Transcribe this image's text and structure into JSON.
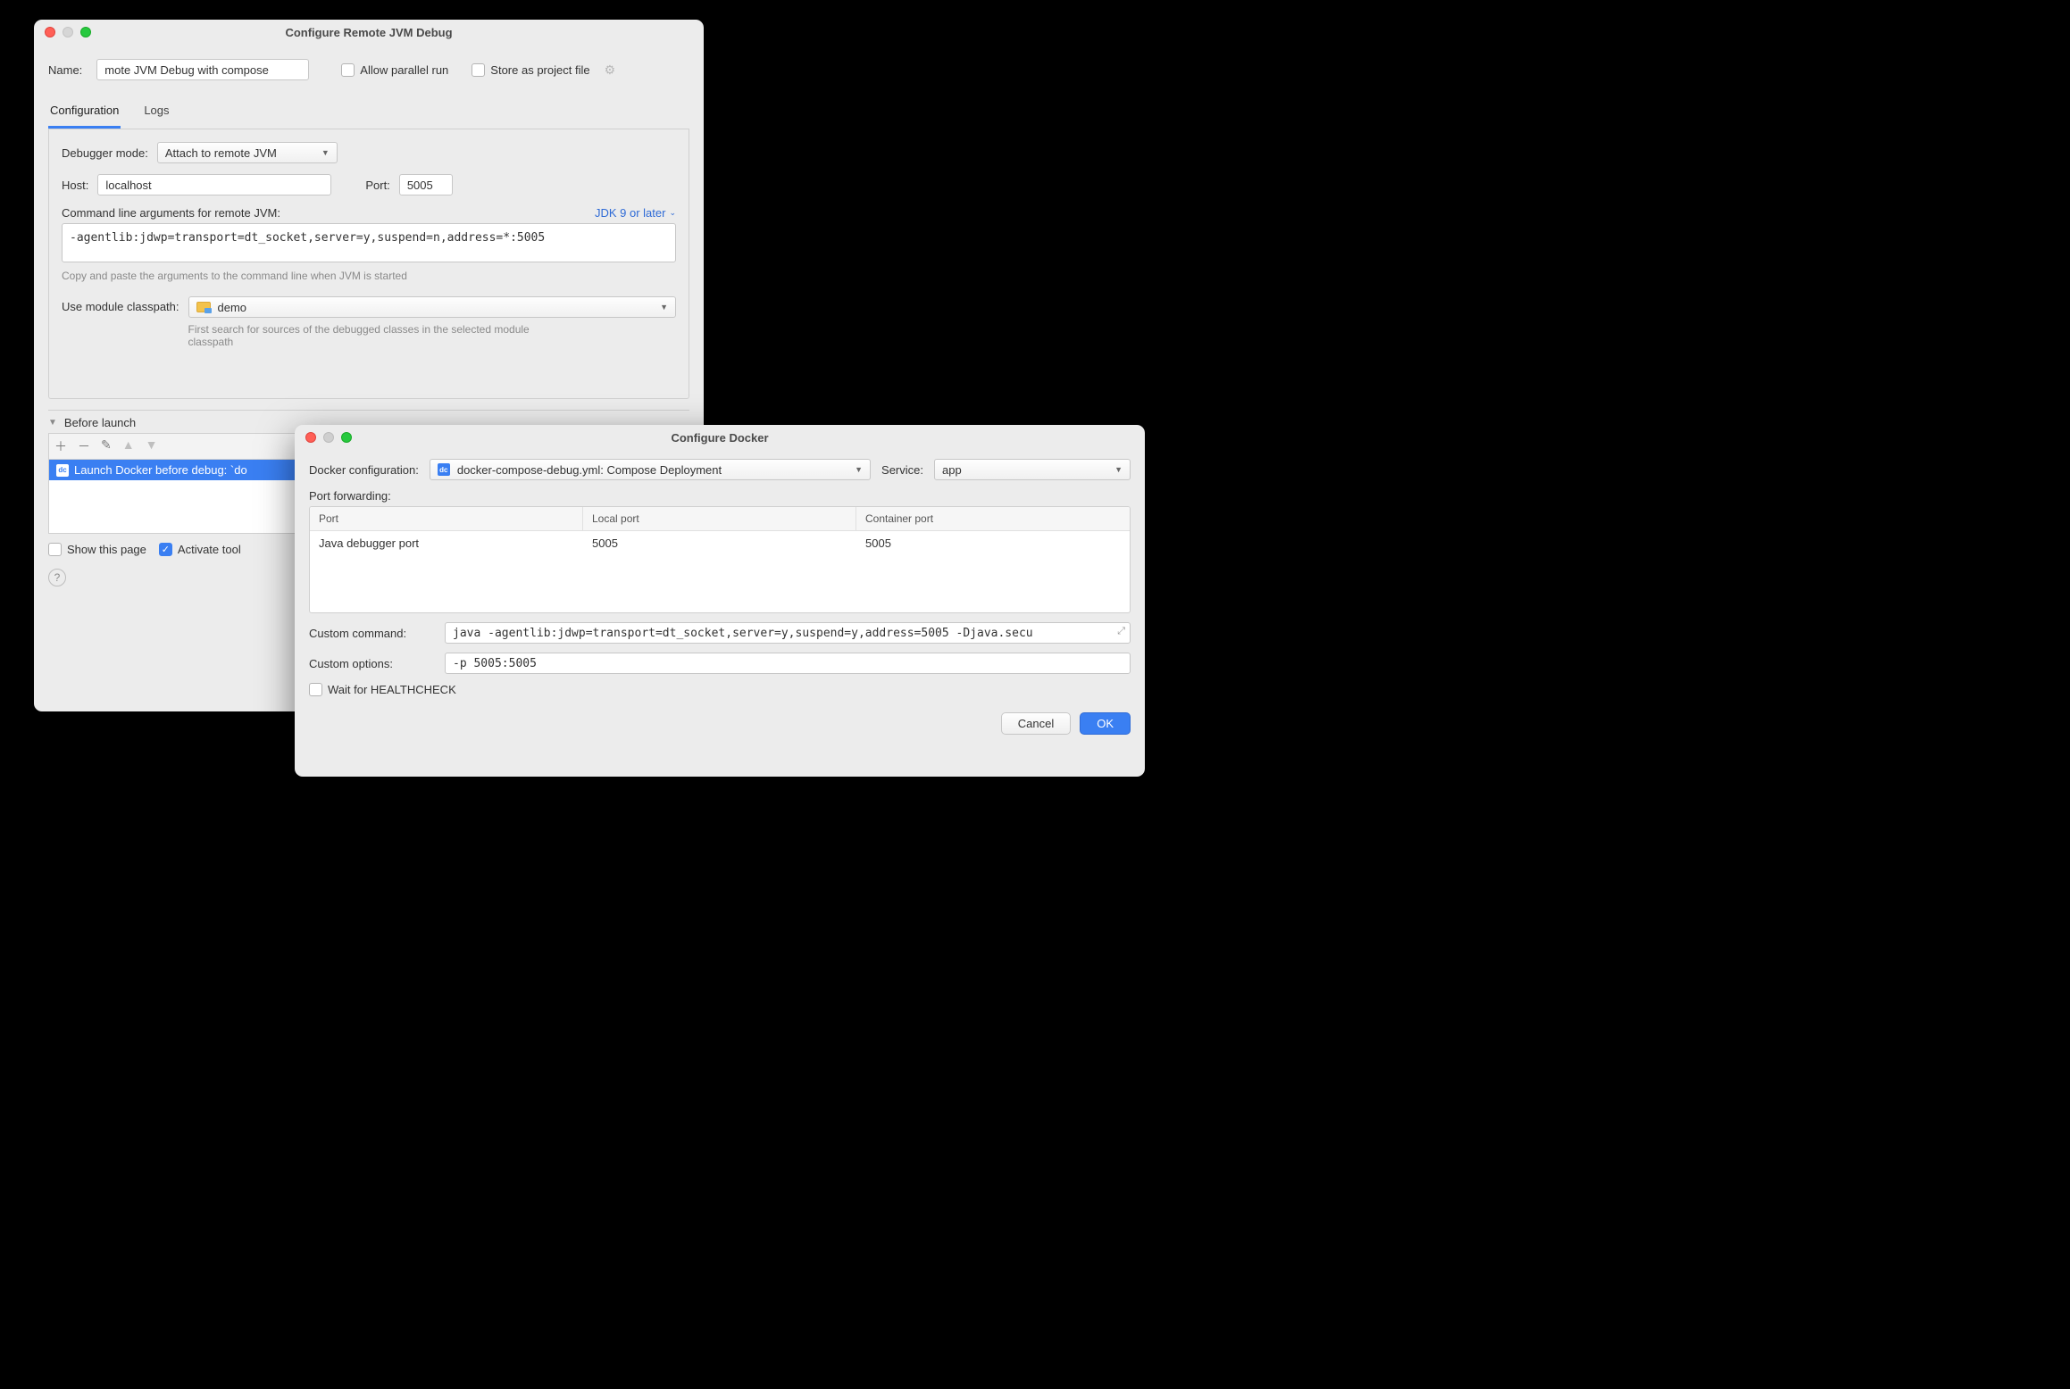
{
  "win1": {
    "title": "Configure Remote JVM Debug",
    "name_label": "Name:",
    "name_value": "mote JVM Debug with compose",
    "allow_parallel": "Allow parallel run",
    "store_as_file": "Store as project file",
    "tabs": {
      "configuration": "Configuration",
      "logs": "Logs"
    },
    "debugger_mode_label": "Debugger mode:",
    "debugger_mode_value": "Attach to remote JVM",
    "host_label": "Host:",
    "host_value": "localhost",
    "port_label": "Port:",
    "port_value": "5005",
    "cli_args_label": "Command line arguments for remote JVM:",
    "jdk_label": "JDK 9 or later",
    "cli_args_value": "-agentlib:jdwp=transport=dt_socket,server=y,suspend=n,address=*:5005",
    "cli_hint": "Copy and paste the arguments to the command line when JVM is started",
    "classpath_label": "Use module classpath:",
    "classpath_value": "demo",
    "classpath_hint": "First search for sources of the debugged classes in the selected module classpath",
    "before_launch": "Before launch",
    "before_item": "Launch Docker before debug:  `do",
    "show_page": "Show this page",
    "activate_tool": "Activate tool"
  },
  "win2": {
    "title": "Configure Docker",
    "docker_conf_label": "Docker configuration:",
    "docker_conf_value": "docker-compose-debug.yml: Compose Deployment",
    "service_label": "Service:",
    "service_value": "app",
    "port_forward_label": "Port forwarding:",
    "columns": {
      "port": "Port",
      "local": "Local port",
      "container": "Container port"
    },
    "row": {
      "port": "Java debugger port",
      "local": "5005",
      "container": "5005"
    },
    "custom_cmd_label": "Custom command:",
    "custom_cmd_value": "java -agentlib:jdwp=transport=dt_socket,server=y,suspend=y,address=5005 -Djava.secu",
    "custom_opts_label": "Custom options:",
    "custom_opts_value": "-p 5005:5005",
    "wait_healthcheck": "Wait for HEALTHCHECK",
    "cancel": "Cancel",
    "ok": "OK"
  }
}
